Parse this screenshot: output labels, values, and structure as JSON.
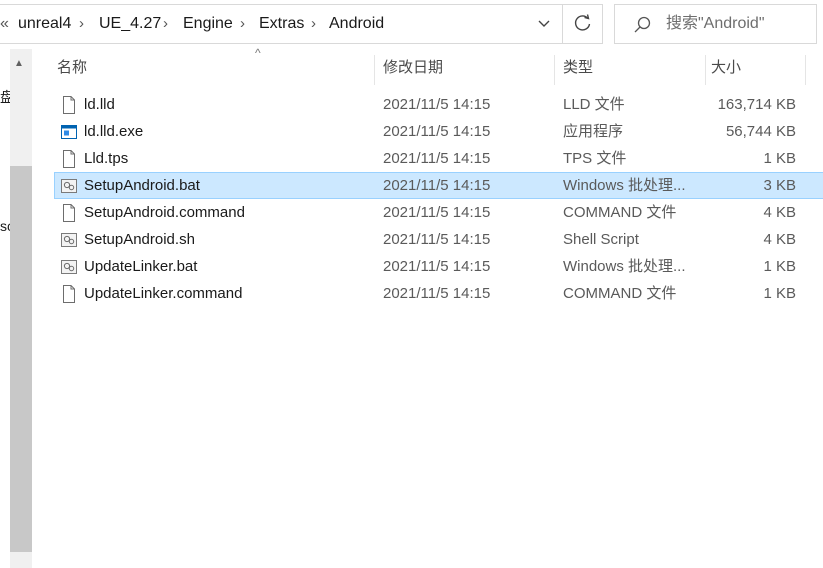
{
  "breadcrumb": {
    "overflow": "«",
    "segments": [
      "unreal4",
      "UE_4.27",
      "Engine",
      "Extras",
      "Android"
    ]
  },
  "search": {
    "placeholder": "搜索\"Android\""
  },
  "left_fragments": [
    "盘",
    "sc"
  ],
  "columns": {
    "name": "名称",
    "date": "修改日期",
    "type": "类型",
    "size": "大小"
  },
  "files": [
    {
      "name": "ld.lld",
      "date": "2021/11/5 14:15",
      "type": "LLD 文件",
      "size": "163,714 KB",
      "icon": "file-icon",
      "selected": false
    },
    {
      "name": "ld.lld.exe",
      "date": "2021/11/5 14:15",
      "type": "应用程序",
      "size": "56,744 KB",
      "icon": "exe-icon",
      "selected": false
    },
    {
      "name": "Lld.tps",
      "date": "2021/11/5 14:15",
      "type": "TPS 文件",
      "size": "1 KB",
      "icon": "file-icon",
      "selected": false
    },
    {
      "name": "SetupAndroid.bat",
      "date": "2021/11/5 14:15",
      "type": "Windows 批处理...",
      "size": "3 KB",
      "icon": "script-icon",
      "selected": true
    },
    {
      "name": "SetupAndroid.command",
      "date": "2021/11/5 14:15",
      "type": "COMMAND 文件",
      "size": "4 KB",
      "icon": "file-icon",
      "selected": false
    },
    {
      "name": "SetupAndroid.sh",
      "date": "2021/11/5 14:15",
      "type": "Shell Script",
      "size": "4 KB",
      "icon": "script-icon",
      "selected": false
    },
    {
      "name": "UpdateLinker.bat",
      "date": "2021/11/5 14:15",
      "type": "Windows 批处理...",
      "size": "1 KB",
      "icon": "script-icon",
      "selected": false
    },
    {
      "name": "UpdateLinker.command",
      "date": "2021/11/5 14:15",
      "type": "COMMAND 文件",
      "size": "1 KB",
      "icon": "file-icon",
      "selected": false
    }
  ],
  "colors": {
    "selection_bg": "#cce8ff",
    "selection_border": "#99d1ff",
    "exe_blue": "#0063b1"
  }
}
